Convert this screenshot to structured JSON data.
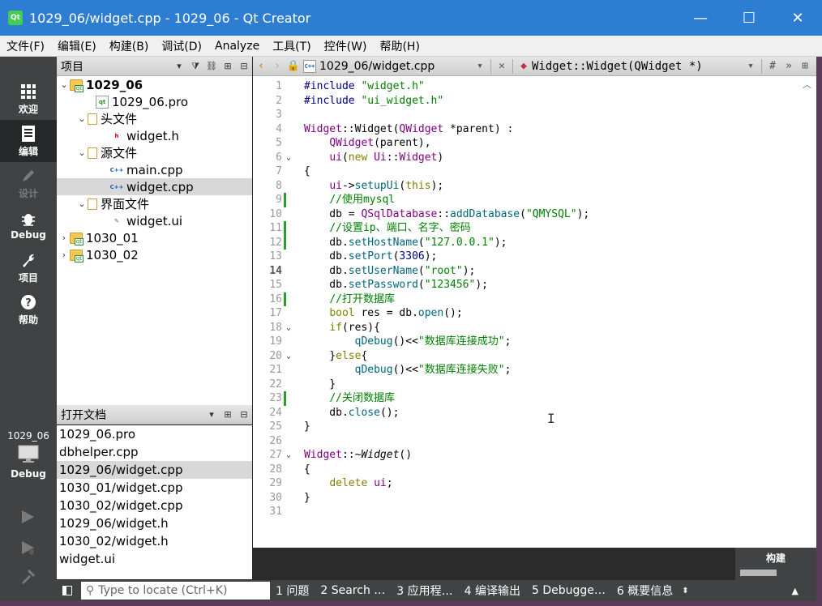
{
  "window": {
    "title": "1029_06/widget.cpp - 1029_06 - Qt Creator",
    "app_icon": "Qt",
    "minimize": "—",
    "maximize": "☐",
    "close": "✕"
  },
  "menu": [
    "文件(F)",
    "编辑(E)",
    "构建(B)",
    "调试(D)",
    "Analyze",
    "工具(T)",
    "控件(W)",
    "帮助(H)"
  ],
  "modes": [
    {
      "label": "欢迎",
      "icon": "grid-icon"
    },
    {
      "label": "编辑",
      "icon": "document-icon"
    },
    {
      "label": "设计",
      "icon": "pencil-icon"
    },
    {
      "label": "Debug",
      "icon": "bug-icon"
    },
    {
      "label": "项目",
      "icon": "wrench-icon"
    },
    {
      "label": "帮助",
      "icon": "question-icon"
    }
  ],
  "kit": {
    "name": "1029_06",
    "mode": "Debug"
  },
  "project_pane": {
    "title": "项目",
    "tree": [
      {
        "label": "1029_06",
        "bold": true
      },
      {
        "label": "1029_06.pro"
      },
      {
        "label": "头文件"
      },
      {
        "label": "widget.h"
      },
      {
        "label": "源文件"
      },
      {
        "label": "main.cpp"
      },
      {
        "label": "widget.cpp"
      },
      {
        "label": "界面文件"
      },
      {
        "label": "widget.ui"
      },
      {
        "label": "1030_01"
      },
      {
        "label": "1030_02"
      }
    ]
  },
  "open_docs": {
    "title": "打开文档",
    "items": [
      "1029_06.pro",
      "dbhelper.cpp",
      "1029_06/widget.cpp",
      "1030_01/widget.cpp",
      "1030_02/widget.cpp",
      "1029_06/widget.h",
      "1030_02/widget.h",
      "widget.ui"
    ]
  },
  "editor_toolbar": {
    "file": "1029_06/widget.cpp",
    "symbol": "Widget::Widget(QWidget *)",
    "hash": "#"
  },
  "code_lines": [
    "1",
    "2",
    "3",
    "4",
    "5",
    "6",
    "7",
    "8",
    "9",
    "10",
    "11",
    "12",
    "13",
    "14",
    "15",
    "16",
    "17",
    "18",
    "19",
    "20",
    "21",
    "22",
    "23",
    "24",
    "25",
    "26",
    "27",
    "28",
    "29",
    "30",
    "31"
  ],
  "code_text": {
    "include1": "\"widget.h\"",
    "include2": "\"ui_widget.h\"",
    "pp": "#include",
    "cm_mysql": "//使用mysql",
    "cm_setup": "//设置ip、端口、名字、密码",
    "cm_open": "//打开数据库",
    "cm_close": "//关闭数据库",
    "str_qmysql": "\"QMYSQL\"",
    "str_host": "\"127.0.0.1\"",
    "num_port": "3306",
    "str_user": "\"root\"",
    "str_pass": "\"123456\"",
    "str_ok": "\"数据库连接成功\"",
    "str_fail": "\"数据库连接失败\""
  },
  "build": {
    "label": "构建",
    "progress": 1.0
  },
  "statusbar": {
    "locator_placeholder": "Type to locate (Ctrl+K)",
    "tabs": [
      "1 问题",
      "2 Search …",
      "3 应用程…",
      "4 编译输出",
      "5 Debugge…",
      "6 概要信息"
    ]
  }
}
